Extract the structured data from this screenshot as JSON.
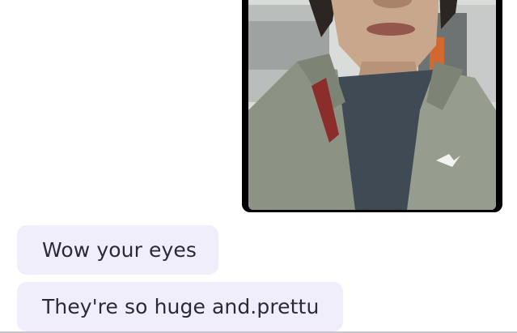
{
  "conversation": {
    "photo_message": {
      "kind": "selfie-photo",
      "direction": "sent"
    },
    "messages": [
      {
        "text": "Wow your eyes",
        "direction": "received"
      },
      {
        "text": "They're so huge and.prettu",
        "direction": "received"
      }
    ]
  },
  "colors": {
    "background": "#ffffff",
    "received_bubble": "#f1eefb",
    "message_text": "#2b2b33",
    "photo_frame": "#000000"
  }
}
